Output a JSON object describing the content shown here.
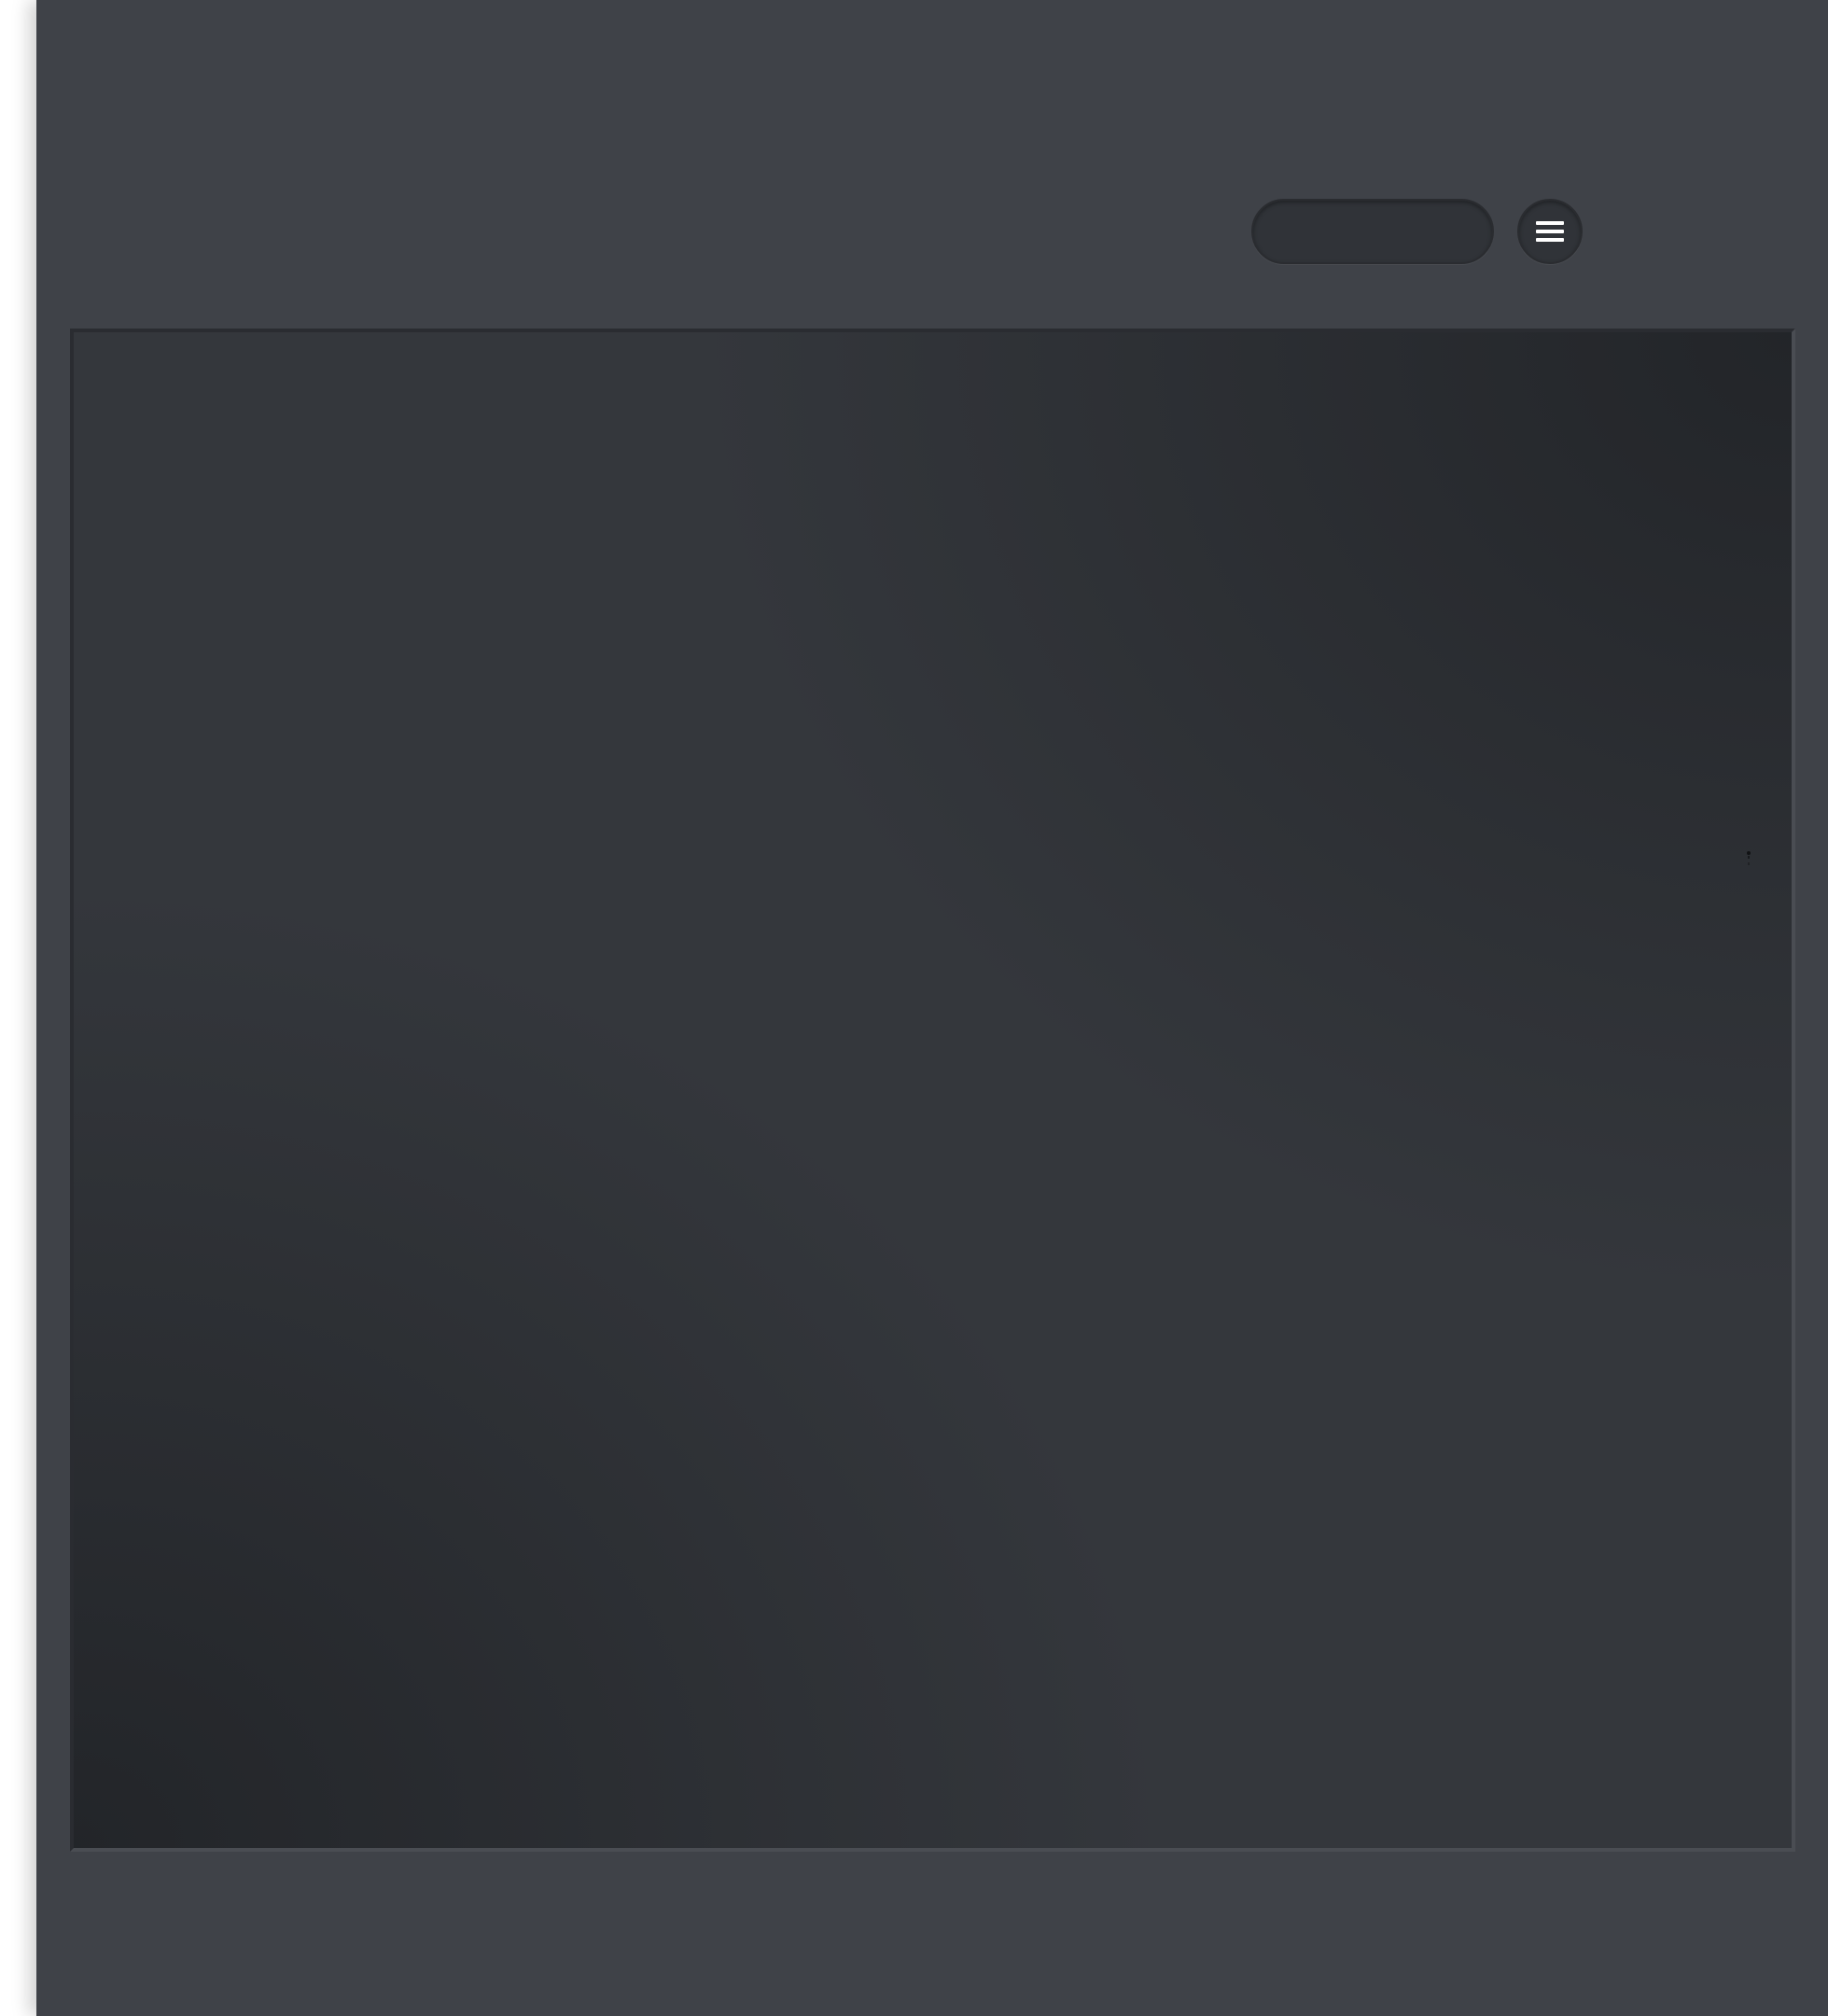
{
  "header": {
    "search": {
      "value": ""
    },
    "menu_button": {
      "icon": "hamburger-menu-icon"
    }
  },
  "canvas": {
    "content": ""
  },
  "colors": {
    "page_background": "#3f4248",
    "canvas_background": "#34373c",
    "control_background": "#303338",
    "icon_color": "#ffffff"
  }
}
